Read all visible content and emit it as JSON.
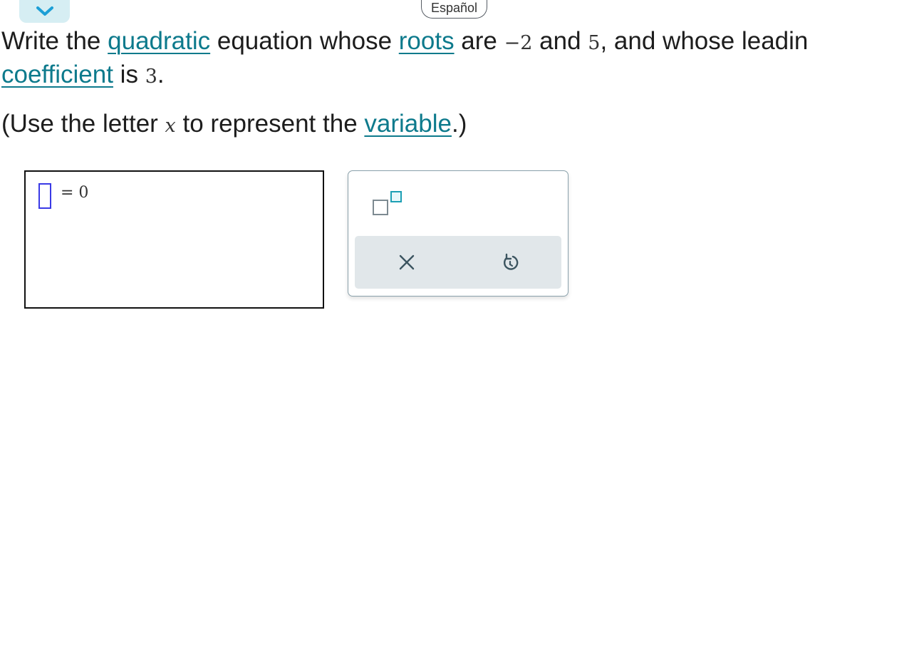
{
  "header": {
    "collapse_icon": "chevron-down-icon",
    "language_label": "Español"
  },
  "question": {
    "line1_a": "Write the ",
    "line1_link1": "quadratic",
    "line1_b": " equation whose ",
    "line1_link2": "roots",
    "line1_c": " are ",
    "root1": "−2",
    "line1_d": " and ",
    "root2": "5",
    "line1_e": ", and whose leadin",
    "line2_link": "coefficient",
    "line2_a": " is ",
    "leading_coeff": "3",
    "line2_b": ".",
    "instr_a": "(Use the letter ",
    "instr_var": "x",
    "instr_b": " to represent the ",
    "instr_link": "variable",
    "instr_c": ".)"
  },
  "answer": {
    "equals_text": "= 0"
  },
  "palette": {
    "exponent_icon": "exponent-template-icon",
    "clear_icon": "close-icon",
    "undo_icon": "undo-icon"
  },
  "colors": {
    "link": "#0d7a8c",
    "accent": "#1d9fb4",
    "slot_border": "#3a3ae6",
    "palette_bar": "#e1e7ea",
    "tab_bg": "#d6eef3"
  }
}
